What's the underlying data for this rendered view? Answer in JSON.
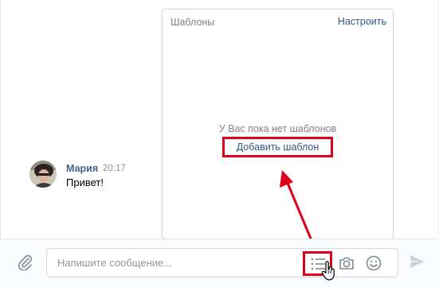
{
  "message": {
    "author": "Мария",
    "time": "20:17",
    "text": "Привет!"
  },
  "templates_popup": {
    "title": "Шаблоны",
    "settings_link": "Настроить",
    "empty_text": "У Вас пока нет шаблонов",
    "add_button": "Добавить шаблон"
  },
  "composer": {
    "placeholder": "Напишите сообщение..."
  },
  "icons": {
    "attach": "paperclip-icon",
    "templates": "templates-list-icon",
    "camera": "camera-icon",
    "emoji": "smile-icon",
    "send": "send-icon",
    "cursor": "hand-cursor-icon"
  },
  "colors": {
    "link": "#2a5885",
    "author": "#42648b",
    "highlight": "#e0001b",
    "icon": "#828a99"
  }
}
